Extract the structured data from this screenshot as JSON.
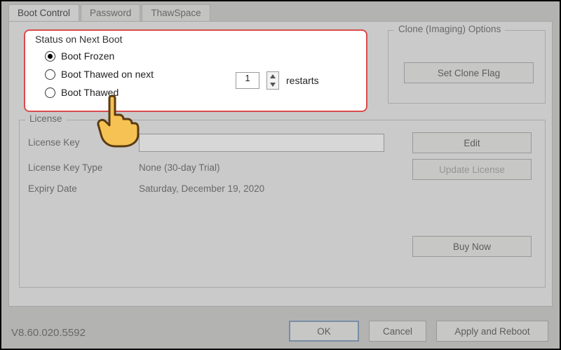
{
  "tabs": {
    "boot_control": "Boot Control",
    "password": "Password",
    "thawspace": "ThawSpace"
  },
  "status": {
    "title": "Status on Next Boot",
    "opt_frozen": "Boot Frozen",
    "opt_thaw_next": "Boot Thawed on next",
    "opt_thawed": "Boot Thawed",
    "restarts_value": "1",
    "restarts_label": "restarts"
  },
  "clone": {
    "title": "Clone (Imaging) Options",
    "set_clone_flag": "Set Clone Flag"
  },
  "license": {
    "title": "License",
    "key_label": "License Key",
    "key_value": "",
    "type_label": "License Key Type",
    "type_value": "None (30-day Trial)",
    "expiry_label": "Expiry Date",
    "expiry_value": "Saturday, December 19, 2020",
    "edit": "Edit",
    "update": "Update License",
    "buy": "Buy Now"
  },
  "footer": {
    "version": "V8.60.020.5592",
    "ok": "OK",
    "cancel": "Cancel",
    "apply": "Apply and Reboot"
  }
}
